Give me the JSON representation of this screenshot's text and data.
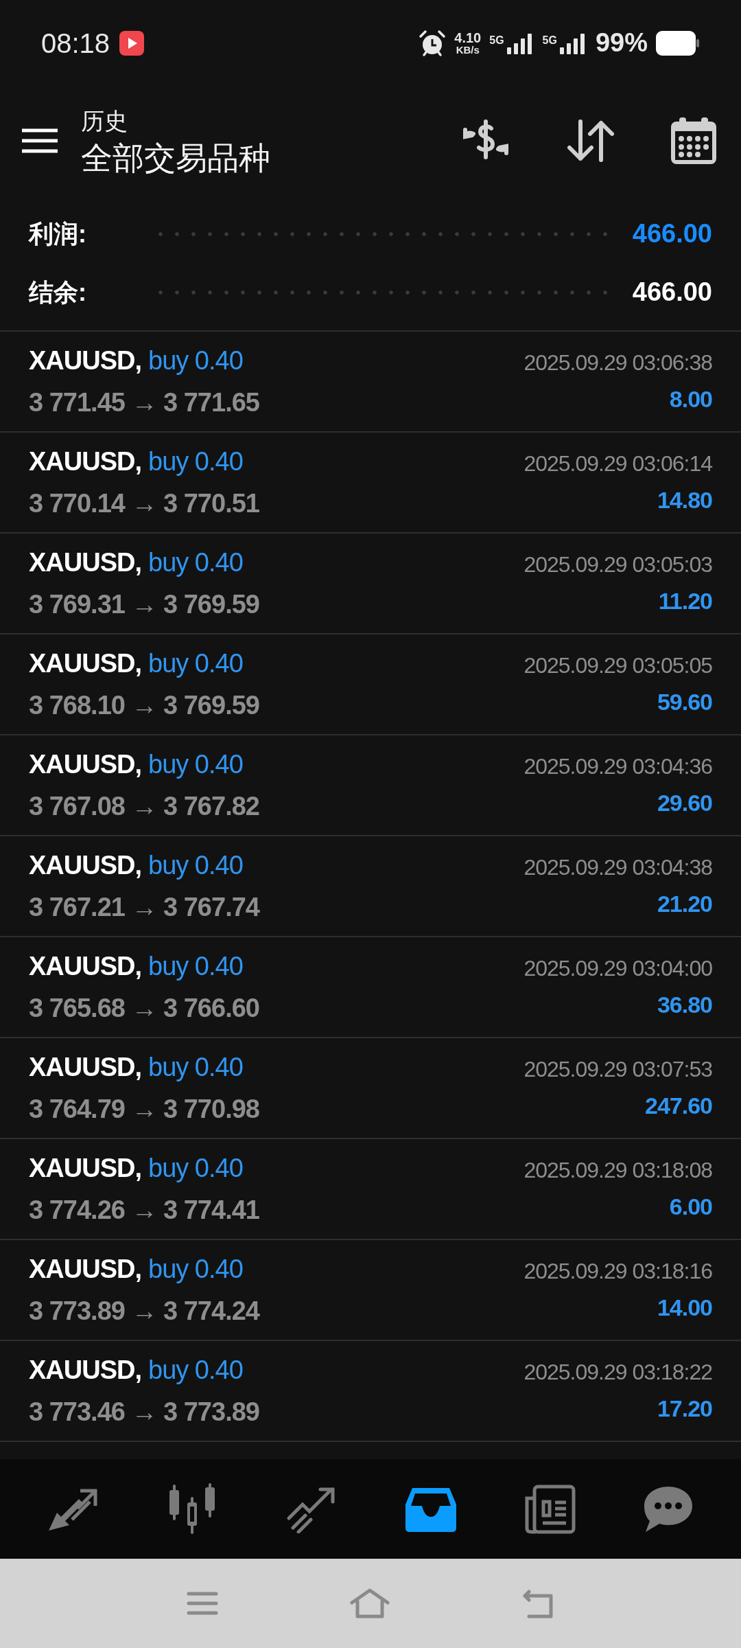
{
  "status_bar": {
    "time": "08:18",
    "speed": "4.10",
    "speed_unit": "KB/s",
    "network_1": "5G",
    "network_2": "5G",
    "battery": "99%"
  },
  "header": {
    "subtitle": "历史",
    "title": "全部交易品种"
  },
  "summary": [
    {
      "label": "利润:",
      "value": "466.00",
      "kind": "profit"
    },
    {
      "label": "结余:",
      "value": "466.00",
      "kind": "balance"
    }
  ],
  "trades": [
    {
      "symbol": "XAUUSD,",
      "side": "buy 0.40",
      "prices": "3 771.45 → 3 771.65",
      "time": "2025.09.29 03:06:38",
      "profit": "8.00"
    },
    {
      "symbol": "XAUUSD,",
      "side": "buy 0.40",
      "prices": "3 770.14 → 3 770.51",
      "time": "2025.09.29 03:06:14",
      "profit": "14.80"
    },
    {
      "symbol": "XAUUSD,",
      "side": "buy 0.40",
      "prices": "3 769.31 → 3 769.59",
      "time": "2025.09.29 03:05:03",
      "profit": "11.20"
    },
    {
      "symbol": "XAUUSD,",
      "side": "buy 0.40",
      "prices": "3 768.10 → 3 769.59",
      "time": "2025.09.29 03:05:05",
      "profit": "59.60"
    },
    {
      "symbol": "XAUUSD,",
      "side": "buy 0.40",
      "prices": "3 767.08 → 3 767.82",
      "time": "2025.09.29 03:04:36",
      "profit": "29.60"
    },
    {
      "symbol": "XAUUSD,",
      "side": "buy 0.40",
      "prices": "3 767.21 → 3 767.74",
      "time": "2025.09.29 03:04:38",
      "profit": "21.20"
    },
    {
      "symbol": "XAUUSD,",
      "side": "buy 0.40",
      "prices": "3 765.68 → 3 766.60",
      "time": "2025.09.29 03:04:00",
      "profit": "36.80"
    },
    {
      "symbol": "XAUUSD,",
      "side": "buy 0.40",
      "prices": "3 764.79 → 3 770.98",
      "time": "2025.09.29 03:07:53",
      "profit": "247.60"
    },
    {
      "symbol": "XAUUSD,",
      "side": "buy 0.40",
      "prices": "3 774.26 → 3 774.41",
      "time": "2025.09.29 03:18:08",
      "profit": "6.00"
    },
    {
      "symbol": "XAUUSD,",
      "side": "buy 0.40",
      "prices": "3 773.89 → 3 774.24",
      "time": "2025.09.29 03:18:16",
      "profit": "14.00"
    },
    {
      "symbol": "XAUUSD,",
      "side": "buy 0.40",
      "prices": "3 773.46 → 3 773.89",
      "time": "2025.09.29 03:18:22",
      "profit": "17.20"
    }
  ],
  "bottom_nav": [
    {
      "kind": "quotes",
      "selected": false
    },
    {
      "kind": "chart",
      "selected": false
    },
    {
      "kind": "trade",
      "selected": false
    },
    {
      "kind": "history",
      "selected": true
    },
    {
      "kind": "news",
      "selected": false
    },
    {
      "kind": "chat",
      "selected": false
    }
  ]
}
